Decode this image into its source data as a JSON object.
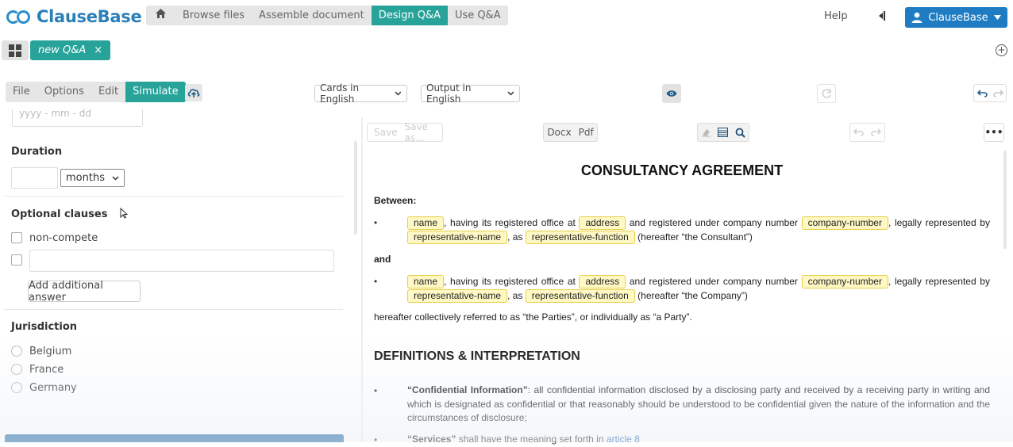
{
  "app": {
    "logo_text": "ClauseBase"
  },
  "top_nav": {
    "items": [
      "Browse files",
      "Assemble document",
      "Design Q&A",
      "Use Q&A"
    ],
    "active": "Design Q&A"
  },
  "header": {
    "help": "Help",
    "user": "ClauseBase"
  },
  "tabs": {
    "qa_tab": "new Q&A",
    "close": "×"
  },
  "menu": {
    "items": [
      "File",
      "Options",
      "Edit",
      "Simulate"
    ],
    "active": "Simulate"
  },
  "toolbar": {
    "cards_lang": "Cards in English",
    "output_lang": "Output in English"
  },
  "form": {
    "date_placeholder": "yyyy - mm - dd",
    "duration": {
      "label": "Duration",
      "value": "",
      "unit": "months"
    },
    "optional_clauses": {
      "label": "Optional clauses",
      "options": [
        "non-compete"
      ],
      "add_answer": "Add additional answer"
    },
    "jurisdiction": {
      "label": "Jurisdiction",
      "options": [
        "Belgium",
        "France",
        "Germany"
      ]
    }
  },
  "doc_toolbar": {
    "save": "Save",
    "save_as": "Save as...",
    "docx": "Docx",
    "pdf": "Pdf"
  },
  "document": {
    "title": "CONSULTANCY AGREEMENT",
    "between": "Between:",
    "and": "and",
    "party1": {
      "ph_name": "name",
      "t1": ", having its registered office at",
      "ph_address": "address",
      "t2": "and registered under company number",
      "ph_company": "company-number",
      "t3": ", legally represented by",
      "ph_rep": "representative-name",
      "t4": ", as",
      "ph_func": "representative-function",
      "t5": "(hereafter “the Consultant”)"
    },
    "party2": {
      "ph_name": "name",
      "t1": ", having its registered office at",
      "ph_address": "address",
      "t2": "and registered under company number",
      "ph_company": "company-number",
      "t3": ", legally represented by",
      "ph_rep": "representative-name",
      "t4": ", as",
      "ph_func": "representative-function",
      "t5": "(hereafter “the Company”)"
    },
    "collective": "hereafter collectively referred to as “the Parties”, or individually as “a Party”.",
    "section_heading": "DEFINITIONS & INTERPRETATION",
    "def1": {
      "term": "“Confidential Information”",
      "text": ": all confidential information disclosed by a disclosing party and received by a receiving party in writing and which is designated as confidential or that reasonably should be understood to be confidential given the nature of the information and the circumstances of disclosure;"
    },
    "def2": {
      "term": "“Services”",
      "text": " shall have the meaning set forth in ",
      "link": "article 8"
    }
  }
}
